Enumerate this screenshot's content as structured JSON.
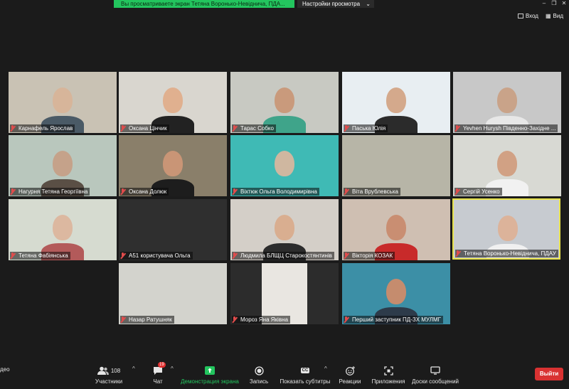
{
  "banner": {
    "share_text": "Вы просматриваете экран Тетяна Воронько-Невіднича, ПДА...",
    "view_settings_label": "Настройки просмотра"
  },
  "window_controls": {
    "minimize": "–",
    "restore": "❐",
    "close": "✕"
  },
  "top_actions": {
    "exit_label": "Вход",
    "view_label": "Вид"
  },
  "participants": [
    {
      "name": "Карнафель Ярослав",
      "bg": "#c9c2b4"
    },
    {
      "name": "Оксана Цінчик",
      "bg": "#d9d6cf"
    },
    {
      "name": "Тарас Собко",
      "bg": "#c8c9c2"
    },
    {
      "name": "Паська Юлія",
      "bg": "#e8eef2"
    },
    {
      "name": "Yevhen Hurysh Південно-Західне ...",
      "bg": "#c8c8c8"
    },
    {
      "name": "Нагурня Тетяна Георгіївна",
      "bg": "#b9c7bd"
    },
    {
      "name": "Оксана Долюк",
      "bg": "#8a7f6a"
    },
    {
      "name": "Віхтюк Ольга Володимирівна",
      "bg": "#3fbab5"
    },
    {
      "name": "Віта Врублевська",
      "bg": "#b7b5a7"
    },
    {
      "name": "Сергій Усенко",
      "bg": "#d8d9d3"
    },
    {
      "name": "Тетяна Фабіянська",
      "bg": "#d6dbd0"
    },
    {
      "name": "А51 користувача Ольга",
      "bg": "#2f2f2f"
    },
    {
      "name": "Людмила БЛЩЦ Старокостянтинів",
      "bg": "#d4cfc8"
    },
    {
      "name": "Вікторія КОЗАК",
      "bg": "#cfbfb2"
    },
    {
      "name": "Тетяна Воронько-Невіднича, ПДАУ",
      "bg": "#c7cbd0"
    },
    {
      "name": "Назар Ратушняк",
      "bg": "#d3d3cd"
    },
    {
      "name": "Мороз Яна Яківна",
      "bg": "#2c2c2c"
    },
    {
      "name": "Перший заступник ПД-ЗХ МУЛМГ",
      "bg": "#3c8fa6"
    }
  ],
  "toolbar": {
    "video_label_cut": "део",
    "participants_count": "108",
    "participants_label": "Участники",
    "chat_badge": "19",
    "chat_label": "Чат",
    "share_label": "Демонстрация экрана",
    "record_label": "Запись",
    "subtitles_label": "Показать субтитры",
    "cc_label": "CC",
    "reactions_label": "Реакции",
    "apps_label": "Приложения",
    "whiteboards_label": "Доски сообщений",
    "leave_label": "Выйти",
    "share_color": "#23c55e",
    "leave_color": "#d93232"
  }
}
